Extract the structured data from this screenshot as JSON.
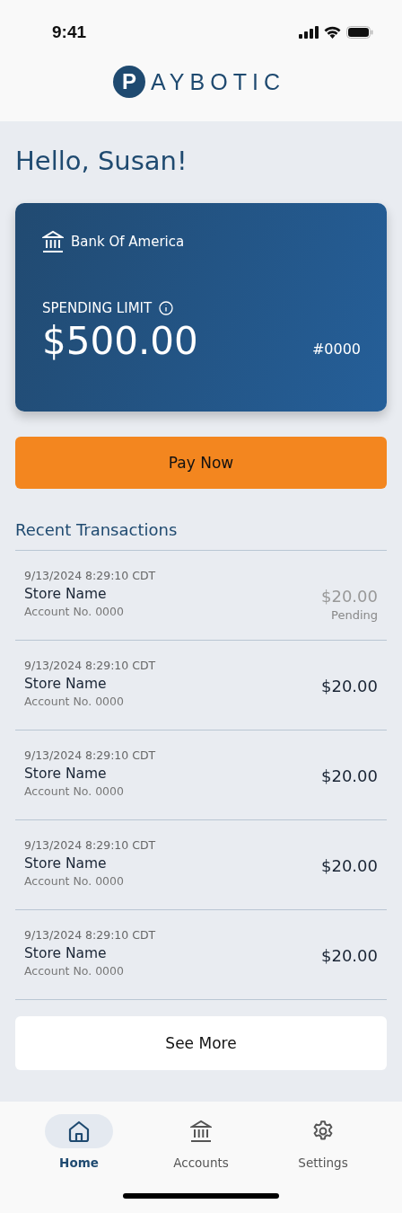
{
  "status_bar": {
    "time": "9:41"
  },
  "logo": {
    "mark": "P",
    "text": "AYBOTIC"
  },
  "greeting": "Hello, Susan!",
  "card": {
    "bank": "Bank Of America",
    "limit_label": "SPENDING LIMIT",
    "amount": "$500.00",
    "number": "#0000"
  },
  "pay_button": "Pay Now",
  "recent_title": "Recent Transactions",
  "transactions": [
    {
      "time": "9/13/2024 8:29:10 CDT",
      "store": "Store Name",
      "account": "Account No. 0000",
      "amount": "$20.00",
      "pending": true,
      "status": "Pending"
    },
    {
      "time": "9/13/2024 8:29:10 CDT",
      "store": "Store Name",
      "account": "Account No. 0000",
      "amount": "$20.00",
      "pending": false
    },
    {
      "time": "9/13/2024 8:29:10 CDT",
      "store": "Store Name",
      "account": "Account No. 0000",
      "amount": "$20.00",
      "pending": false
    },
    {
      "time": "9/13/2024 8:29:10 CDT",
      "store": "Store Name",
      "account": "Account No. 0000",
      "amount": "$20.00",
      "pending": false
    },
    {
      "time": "9/13/2024 8:29:10 CDT",
      "store": "Store Name",
      "account": "Account No. 0000",
      "amount": "$20.00",
      "pending": false
    }
  ],
  "see_more": "See More",
  "nav": [
    {
      "label": "Home",
      "kind": "home",
      "selected": true
    },
    {
      "label": "Accounts",
      "kind": "bank",
      "selected": false
    },
    {
      "label": "Settings",
      "kind": "gear",
      "selected": false
    }
  ]
}
